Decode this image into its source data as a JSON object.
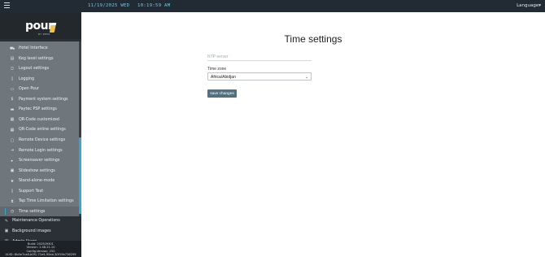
{
  "topbar": {
    "date": "11/19/2025 WED",
    "time": "10:19:59 AM",
    "language_label": "Language",
    "language_caret": "▾"
  },
  "logo": {
    "word": "pour",
    "sub": "BY BEER"
  },
  "submenu": [
    {
      "label": "Hotel Interface",
      "icon": "bed-icon",
      "glyph": "⛟"
    },
    {
      "label": "Keg level settings",
      "icon": "keg-icon",
      "glyph": "▤"
    },
    {
      "label": "Logout settings",
      "icon": "logout-icon",
      "glyph": "⎋"
    },
    {
      "label": "Logging",
      "icon": "log-icon",
      "glyph": "▯"
    },
    {
      "label": "Open Pour",
      "icon": "pour-icon",
      "glyph": "▭"
    },
    {
      "label": "Payment system settings",
      "icon": "dollar-icon",
      "glyph": "$"
    },
    {
      "label": "Paytec PSP settings",
      "icon": "card-icon",
      "glyph": "▬"
    },
    {
      "label": "QR-Code customized",
      "icon": "qr-icon",
      "glyph": "▦"
    },
    {
      "label": "QR-Code online settings",
      "icon": "qr-online-icon",
      "glyph": "▦"
    },
    {
      "label": "Remote Device settings",
      "icon": "remote-device-icon",
      "glyph": "▢"
    },
    {
      "label": "Remote Login settings",
      "icon": "remote-login-icon",
      "glyph": "⇥"
    },
    {
      "label": "Screensaver settings",
      "icon": "screensaver-icon",
      "glyph": "▸"
    },
    {
      "label": "Slideshow settings",
      "icon": "slideshow-icon",
      "glyph": "▣"
    },
    {
      "label": "Stand-alone-mode",
      "icon": "star-icon",
      "glyph": "★"
    },
    {
      "label": "Support Text",
      "icon": "text-icon",
      "glyph": "▯"
    },
    {
      "label": "Tap Time Limitation settings",
      "icon": "hourglass-icon",
      "glyph": "⧗"
    },
    {
      "label": "Time settings",
      "icon": "clock-icon",
      "glyph": "◷",
      "active": true
    }
  ],
  "mainmenu": [
    {
      "label": "Maintenance Operations",
      "icon": "wrench-icon",
      "glyph": "✎"
    },
    {
      "label": "Background images",
      "icon": "image-icon",
      "glyph": "▣"
    },
    {
      "label": "Admin Users",
      "icon": "users-icon",
      "glyph": "☺"
    }
  ],
  "footer": {
    "build": "Build: 202509301",
    "version": "Version: 1.48.21.10",
    "config": "Config-Version: 252",
    "uuid": "UUID: 8b0e7ca6-b0f1-71e4-95ea-30f19b736299"
  },
  "main": {
    "title": "Time settings",
    "ntp_placeholder": "NTP-server",
    "timezone_label": "Time zone",
    "timezone_value": "Africa/Abidjan",
    "save_label": "save changes"
  },
  "colors": {
    "topbar": "#222b33",
    "sidebar": "#2b3036",
    "submenu": "#6f767c",
    "accent": "#2ea8d8",
    "button": "#54707f"
  }
}
